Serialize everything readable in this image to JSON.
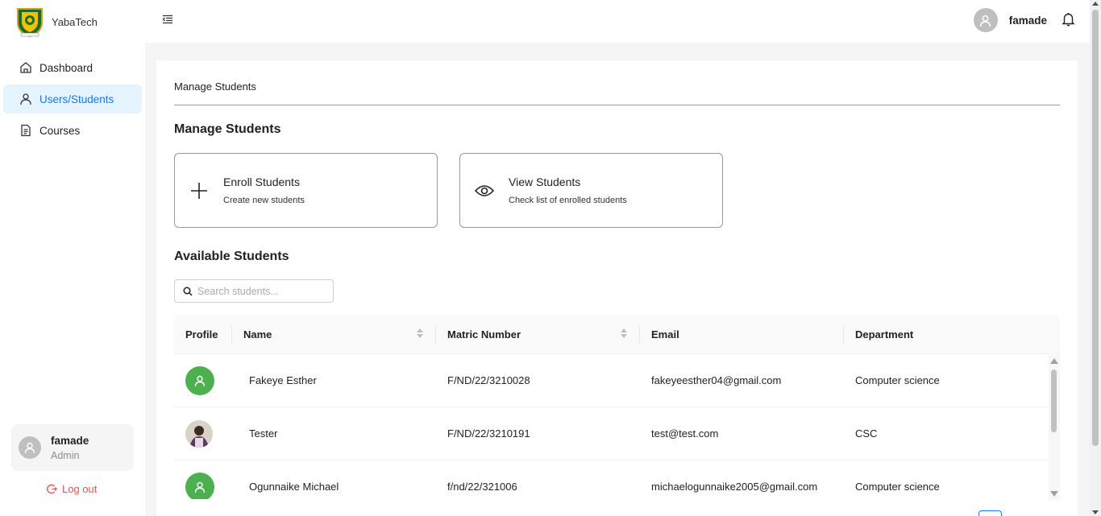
{
  "app": {
    "name": "YabaTech"
  },
  "sidebar": {
    "items": [
      {
        "label": "Dashboard",
        "icon": "home-icon",
        "active": false
      },
      {
        "label": "Users/Students",
        "icon": "user-icon",
        "active": true
      },
      {
        "label": "Courses",
        "icon": "document-icon",
        "active": false
      }
    ],
    "user": {
      "name": "famade",
      "role": "Admin"
    },
    "logout_label": "Log out"
  },
  "topbar": {
    "username": "famade",
    "icons": [
      "menu-fold-icon",
      "avatar-icon",
      "bell-icon"
    ]
  },
  "main": {
    "breadcrumb": "Manage Students",
    "heading": "Manage Students",
    "cards": [
      {
        "title": "Enroll Students",
        "subtitle": "Create new students",
        "icon": "plus-icon"
      },
      {
        "title": "View Students",
        "subtitle": "Check list of enrolled students",
        "icon": "eye-icon"
      }
    ],
    "available_heading": "Available Students",
    "search": {
      "placeholder": "Search students...",
      "value": ""
    },
    "table": {
      "columns": [
        "Profile",
        "Name",
        "Matric Number",
        "Email",
        "Department"
      ],
      "rows": [
        {
          "avatar": "default",
          "name": "Fakeye Esther",
          "matric": "F/ND/22/3210028",
          "email": "fakeyeesther04@gmail.com",
          "department": "Computer science"
        },
        {
          "avatar": "photo",
          "name": "Tester",
          "matric": "F/ND/22/3210191",
          "email": "test@test.com",
          "department": "CSC"
        },
        {
          "avatar": "default",
          "name": "Ogunnaike Michael",
          "matric": "f/nd/22/321006",
          "email": "michaelogunnaike2005@gmail.com",
          "department": "Computer science"
        }
      ]
    }
  },
  "colors": {
    "accent": "#1677ff",
    "active_bg": "#e6f4ff",
    "avatar_green": "#4caf50",
    "danger": "#ff4d4f"
  }
}
